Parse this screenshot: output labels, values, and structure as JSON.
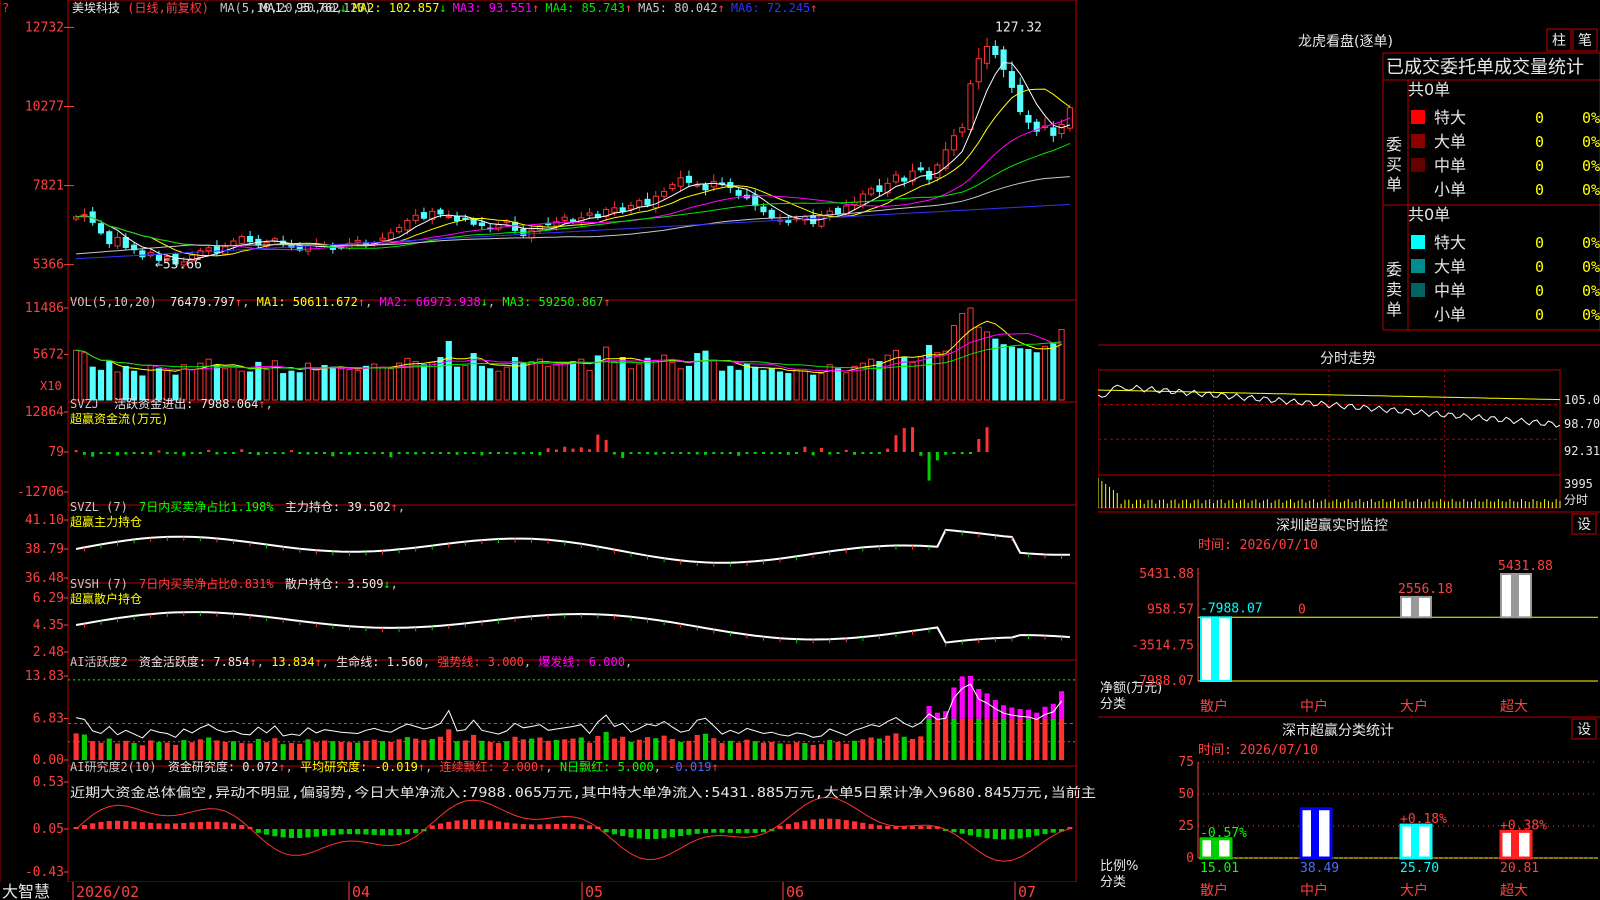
{
  "colors": {
    "up": "#ff3232",
    "down": "#54ffff",
    "bg": "#000000",
    "grid": "#b40000",
    "ma1": "#ffffff",
    "ma2": "#ffff00",
    "ma3": "#ff00ff",
    "ma4": "#00e600",
    "ma5": "#c8c8c8",
    "ma6": "#3232ff",
    "label_red": "#ff4040",
    "label_yellow": "#ffff00",
    "label_green": "#00ff00",
    "label_magenta": "#ff00ff",
    "label_blue": "#4a6cff"
  },
  "stock": {
    "flag": "?",
    "name": "美埃科技",
    "mode": "(日线,前复权)"
  },
  "price_panel": {
    "ma_header": "MA(5,10,20,30,60,120)",
    "ma": [
      {
        "label": "MA1:",
        "value": "95.762",
        "arrow": "↓"
      },
      {
        "label": "MA2:",
        "value": "102.857",
        "arrow": "↓"
      },
      {
        "label": "MA3:",
        "value": "93.551",
        "arrow": "↑"
      },
      {
        "label": "MA4:",
        "value": "85.743",
        "arrow": "↑"
      },
      {
        "label": "MA5:",
        "value": "80.042",
        "arrow": "↑"
      },
      {
        "label": "MA6:",
        "value": "72.245",
        "arrow": "↑"
      }
    ],
    "high_label": "127.32",
    "low_label": "←53.66",
    "y_ticks": [
      "12732",
      "10277",
      "7821",
      "5366"
    ]
  },
  "vol_panel": {
    "header": "VOL(5,10,20)",
    "value": "76479.797",
    "ma1": "MA1: 50611.672",
    "ma2": "MA2: 66973.938",
    "ma3": "MA3: 59250.867",
    "ma1_arrow": "↑",
    "ma2_arrow": "↓",
    "ma3_arrow": "↑",
    "value_arrow": "↑",
    "y_ticks": [
      "11486",
      "5672"
    ],
    "unit": "X10"
  },
  "svzj_panel": {
    "header": "SVZJ",
    "title": "活跃资金进出:",
    "value": "7988.064",
    "arrow": "↑",
    "sub": "超赢资金流(万元)",
    "y_ticks": [
      "12864",
      "79",
      "-12706"
    ]
  },
  "svzl_panel": {
    "header": "SVZL (7)",
    "ratio": "7日内买卖净占比1.198%",
    "hold": "主力持仓: 39.502",
    "arrow": "↑",
    "sub": "超赢主力持仓",
    "y_ticks": [
      "41.10",
      "38.79",
      "36.48"
    ]
  },
  "svsh_panel": {
    "header": "SVSH (7)",
    "ratio": "7日内买卖净占比0.831%",
    "hold": "散户持仓: 3.509",
    "arrow": "↓",
    "sub": "超赢散户持仓",
    "y_ticks": [
      "6.29",
      "4.35",
      "2.48"
    ]
  },
  "ai_panel": {
    "header": "AI活跃度2",
    "a": "资金活跃度: 7.854",
    "b": "13.834",
    "c": "生命线: 1.560",
    "d": "强势线: 3.000",
    "e": "爆发线: 6.000",
    "y_ticks": [
      "13.83",
      "6.83",
      "0.00"
    ]
  },
  "ai2_panel": {
    "header": "AI研究度2(10)",
    "a": "资金研究度: 0.072",
    "b": "平均研究度: -0.019",
    "c": "连续飘红: 2.000",
    "d": "N日飘红: 5.000",
    "e": "-0.019",
    "text": "近期大资金总体偏空,异动不明显,偏弱势,今日大单净流入:7988.065万元,其中特大单净流入:5431.885万元,大单5日累计净入9680.845万元,当前主",
    "y_ticks": [
      "0.53",
      "0.05",
      "-0.43"
    ]
  },
  "x_axis": {
    "labels": [
      "2026/02",
      "04",
      "05",
      "06",
      "07"
    ]
  },
  "brand": "大智慧",
  "dragon_tiger": {
    "title": "龙虎看盘(逐单)",
    "btn1": "柱",
    "btn2": "笔",
    "subtitle": "已成交委托单成交量统计",
    "buy": {
      "side": "委买单",
      "total": "共0单",
      "rows": [
        {
          "name": "特大",
          "count": "0",
          "pct": "0%",
          "color": "#ff0000"
        },
        {
          "name": "大单",
          "count": "0",
          "pct": "0%",
          "color": "#8c0000"
        },
        {
          "name": "中单",
          "count": "0",
          "pct": "0%",
          "color": "#640000"
        },
        {
          "name": "小单",
          "count": "0",
          "pct": "0%",
          "color": "#000000"
        }
      ]
    },
    "sell": {
      "side": "委卖单",
      "total": "共0单",
      "rows": [
        {
          "name": "特大",
          "count": "0",
          "pct": "0%",
          "color": "#00ffff"
        },
        {
          "name": "大单",
          "count": "0",
          "pct": "0%",
          "color": "#008c8c"
        },
        {
          "name": "中单",
          "count": "0",
          "pct": "0%",
          "color": "#006464"
        },
        {
          "name": "小单",
          "count": "0",
          "pct": "0%",
          "color": "#000000"
        }
      ]
    }
  },
  "intraday": {
    "title": "分时走势",
    "y_ticks": [
      "105.0",
      "98.70",
      "92.31"
    ],
    "vol_tick": "3995",
    "vol_label": "分时"
  },
  "monitor": {
    "title": "深圳超赢实时监控",
    "btn": "设",
    "time": "时间: 2026/07/10",
    "y_label": "净额(万元)",
    "x_label": "分类"
  },
  "classify": {
    "title": "深市超赢分类统计",
    "btn": "设",
    "time": "时间: 2026/07/10",
    "y_label": "比例%",
    "x_label": "分类"
  },
  "chart_data": [
    {
      "type": "candlestick",
      "title": "美埃科技 (日线,前复权)",
      "ylim": [
        53.66,
        127.32
      ],
      "high_marker": 127.32,
      "low_marker": 53.66,
      "ma": {
        "MA1": 95.762,
        "MA2": 102.857,
        "MA3": 93.551,
        "MA4": 85.743,
        "MA5": 80.042,
        "MA6": 72.245
      },
      "closes": [
        68.5,
        69.2,
        66.8,
        63.5,
        60.2,
        62.1,
        59.0,
        58.3,
        56.1,
        57.4,
        55.0,
        56.2,
        53.9,
        54.5,
        56.6,
        58.0,
        58.9,
        57.3,
        59.2,
        61.0,
        62.4,
        60.8,
        59.7,
        60.5,
        61.7,
        60.1,
        59.0,
        58.2,
        59.5,
        60.2,
        59.6,
        58.4,
        59.1,
        60.3,
        61.2,
        59.8,
        60.5,
        61.9,
        63.5,
        65.2,
        67.4,
        69.0,
        68.1,
        70.2,
        69.4,
        68.6,
        67.3,
        68.1,
        66.2,
        65.8,
        64.7,
        66.0,
        67.2,
        64.3,
        62.7,
        64.4,
        65.7,
        66.1,
        67.0,
        68.4,
        66.9,
        68.2,
        69.7,
        68.3,
        70.8,
        71.3,
        70.1,
        72.0,
        73.5,
        72.2,
        74.9,
        76.4,
        78.5,
        80.6,
        79.2,
        78.4,
        76.9,
        79.5,
        78.7,
        77.6,
        75.2,
        74.4,
        72.0,
        70.1,
        68.3,
        67.5,
        66.8,
        67.9,
        68.5,
        66.4,
        68.8,
        70.3,
        69.5,
        71.9,
        73.1,
        75.6,
        77.2,
        76.4,
        78.9,
        81.5,
        79.6,
        82.7,
        83.1,
        80.2,
        84.6,
        89.3,
        93.7,
        96.2,
        109.8,
        117.6,
        121.4,
        118.9,
        114.3,
        108.7,
        101.2,
        97.9,
        95.1,
        96.7,
        93.8,
        97.2,
        102.4
      ]
    },
    {
      "type": "bar",
      "title": "VOL(5,10,20)",
      "ylim": [
        0,
        11486
      ],
      "values": [
        6200,
        5900,
        4100,
        3700,
        4800,
        3500,
        4200,
        3600,
        3000,
        4300,
        3900,
        3700,
        3100,
        4400,
        3800,
        4600,
        5100,
        4300,
        3900,
        4100,
        3600,
        3500,
        4700,
        3800,
        4900,
        3300,
        3600,
        3400,
        4600,
        3800,
        4300,
        4100,
        3900,
        3800,
        3700,
        4200,
        4500,
        4100,
        3900,
        4600,
        5200,
        4800,
        4400,
        4700,
        5300,
        7300,
        4100,
        4300,
        5800,
        4200,
        3900,
        3600,
        4100,
        5300,
        4600,
        4800,
        5100,
        4200,
        4400,
        4600,
        4800,
        5100,
        3700,
        5500,
        6600,
        4800,
        5300,
        3900,
        4500,
        5200,
        4900,
        5600,
        4700,
        3900,
        4200,
        5800,
        6100,
        4900,
        3600,
        4200,
        3700,
        4500,
        4100,
        3700,
        3900,
        3500,
        3300,
        3800,
        3600,
        3100,
        3300,
        4400,
        3900,
        3400,
        4200,
        4600,
        5100,
        4800,
        5600,
        6200,
        5300,
        4700,
        5400,
        6800,
        5900,
        6100,
        9300,
        10800,
        11486,
        9100,
        8500,
        7600,
        6900,
        6600,
        6400,
        6300,
        5900,
        6700,
        7100,
        8800
      ]
    },
    {
      "type": "bar",
      "title": "SVZJ 活跃资金进出",
      "ylim": [
        -12706,
        12864
      ],
      "values": [
        600,
        -900,
        -1500,
        -700,
        -400,
        -1100,
        -800,
        -600,
        -300,
        -900,
        500,
        -700,
        -400,
        -1200,
        -600,
        -300,
        700,
        -800,
        -500,
        -400,
        900,
        -600,
        -1000,
        -500,
        -300,
        -700,
        600,
        -400,
        -800,
        -500,
        -300,
        -1400,
        -600,
        -900,
        -300,
        -500,
        -700,
        -400,
        -1700,
        -400,
        -500,
        -800,
        -300,
        -600,
        -400,
        -300,
        -900,
        -700,
        -500,
        -1100,
        -600,
        -400,
        -300,
        -800,
        -700,
        -500,
        -1100,
        1200,
        800,
        1700,
        1100,
        1500,
        900,
        5600,
        3900,
        -800,
        -1900,
        -600,
        -400,
        -700,
        -900,
        -500,
        -300,
        -400,
        -600,
        -800,
        -900,
        -500,
        -700,
        -400,
        -1200,
        -300,
        -600,
        -500,
        -700,
        -400,
        -900,
        -500,
        1700,
        -1100,
        1300,
        -800,
        -600,
        700,
        -900,
        -500,
        -600,
        -400,
        1100,
        5400,
        7700,
        7988,
        -1200,
        -9200,
        -2700,
        -900,
        -500,
        -700,
        -300,
        4200,
        7988
      ]
    },
    {
      "type": "line",
      "title": "SVZL 主力持仓",
      "ylim": [
        36.48,
        41.1
      ],
      "last": 39.502
    },
    {
      "type": "line",
      "title": "SVSH 散户持仓",
      "ylim": [
        2.48,
        6.29
      ],
      "last": 3.509
    },
    {
      "type": "bar",
      "title": "AI活跃度2",
      "ylim": [
        0,
        13.83
      ],
      "lines": {
        "资金活跃度": 7.854,
        "生命线": 1.56,
        "强势线": 3.0,
        "爆发线": 6.0
      }
    },
    {
      "type": "bar",
      "title": "AI研究度2(10)",
      "ylim": [
        -0.43,
        0.53
      ],
      "lines": {
        "资金研究度": 0.072,
        "平均研究度": -0.019
      }
    },
    {
      "type": "bar",
      "title": "深圳超赢实时监控",
      "categories": [
        "散户",
        "中户",
        "大户",
        "超大"
      ],
      "values": [
        -7988.07,
        0,
        2556.18,
        5431.88
      ],
      "value_labels": [
        "-7988.07",
        "0",
        "2556.18",
        "5431.88"
      ],
      "y_ticks": [
        "5431.88",
        "958.57",
        "-3514.75",
        "-7988.07"
      ],
      "ylim": [
        -7988.07,
        5431.88
      ]
    },
    {
      "type": "bar",
      "title": "深市超赢分类统计",
      "categories": [
        "散户",
        "中户",
        "大户",
        "超大"
      ],
      "values": [
        15.01,
        38.49,
        25.7,
        20.81
      ],
      "value_labels": [
        "15.01",
        "38.49",
        "25.70",
        "20.81"
      ],
      "change_labels": [
        "-0.57%",
        "",
        "+0.18%",
        "+0.38%"
      ],
      "y_ticks": [
        "75",
        "50",
        "25",
        "0"
      ],
      "ylim": [
        0,
        75
      ]
    }
  ]
}
